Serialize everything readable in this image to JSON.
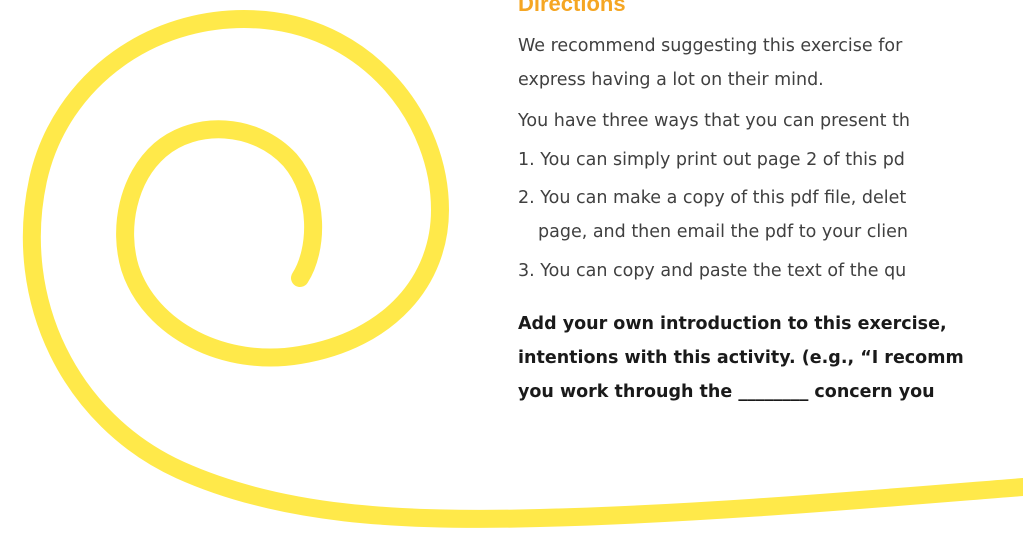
{
  "document": {
    "heading": "Directions",
    "lines": [
      "We recommend suggesting this exercise for",
      "express having a lot on their mind.",
      "You have three ways that you can present th",
      "1. You can simply print out page 2 of this pd",
      "2. You can make a copy of this pdf file, delet",
      "page, and then email the pdf to your clien",
      "3. You can copy and paste the text of the qu"
    ],
    "bold_lines": [
      "Add your own introduction to this exercise,",
      "intentions with this activity. (e.g., “I recomm",
      "you work through the ________ concern you"
    ]
  },
  "colors": {
    "heading": "#f5a623",
    "swirl": "#ffe94a",
    "body_text": "#404040",
    "bold_text": "#1a1a1a"
  }
}
